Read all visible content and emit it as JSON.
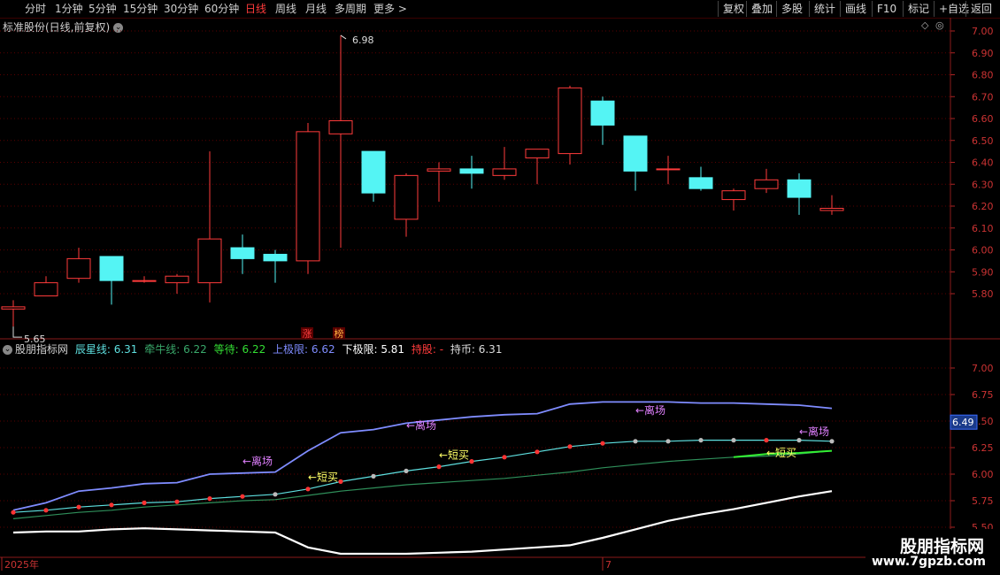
{
  "toolbar": {
    "periods": [
      "分时",
      "1分钟",
      "5分钟",
      "15分钟",
      "30分钟",
      "60分钟",
      "日线",
      "周线",
      "月线",
      "多周期",
      "更多 >"
    ],
    "active_period": "日线",
    "right_buttons": [
      "复权",
      "叠加",
      "多股",
      "统计",
      "画线",
      "F10",
      "标记",
      "+自选",
      "返回"
    ]
  },
  "main_title": "标准股份(日线,前复权)",
  "main_chart": {
    "high_label": "6.98",
    "low_label": "5.65",
    "badges": [
      "涨",
      "榜"
    ]
  },
  "indicator": {
    "name": "股朋指标网",
    "items": [
      {
        "label": "辰星线:",
        "value": "6.31",
        "color": "#5ee0e0"
      },
      {
        "label": "牵牛线:",
        "value": "6.22",
        "color": "#39a86a"
      },
      {
        "label": "等待:",
        "value": "6.22",
        "color": "#33dd33"
      },
      {
        "label": "上极限:",
        "value": "6.62",
        "color": "#7f8cff"
      },
      {
        "label": "下极限:",
        "value": "5.81",
        "color": "#ffffff"
      },
      {
        "label": "持股:",
        "value": "-",
        "color": "#ff3b3b"
      },
      {
        "label": "持币:",
        "value": "6.31",
        "color": "#dddddd"
      }
    ],
    "current_value_tag": "6.49",
    "annotations": [
      {
        "text": "←离场",
        "color": "#e080ff",
        "x": 12,
        "y": 6.46
      },
      {
        "text": "←离场",
        "color": "#e080ff",
        "x": 7,
        "y": 6.12
      },
      {
        "text": "←离场",
        "color": "#e080ff",
        "x": 19,
        "y": 6.6
      },
      {
        "text": "←离场",
        "color": "#e080ff",
        "x": 24,
        "y": 6.4
      },
      {
        "text": "←短买",
        "color": "#ffff66",
        "x": 13,
        "y": 6.18
      },
      {
        "text": "←短买",
        "color": "#ffff66",
        "x": 9,
        "y": 5.97
      },
      {
        "text": "←短买",
        "color": "#ffff66",
        "x": 23,
        "y": 6.2
      }
    ]
  },
  "time_axis": {
    "labels": [
      "2025年",
      "7"
    ]
  },
  "watermark": {
    "title": "股朋指标网",
    "url": "www.7gpzb.com"
  },
  "colors": {
    "up": "#ff3b3b",
    "down": "#54f4f4",
    "grid": "#5a0000",
    "axis_text": "#cc3333",
    "upper": "#7f8cff",
    "star": "#5ee0e0",
    "ox": "#2f8f5a",
    "wait": "#33ee33",
    "lower": "#ffffff"
  },
  "chart_data": [
    {
      "type": "candlestick",
      "title": "标准股份(日线,前复权)",
      "ylim": [
        5.72,
        7.04
      ],
      "yticks": [
        5.8,
        5.9,
        6.0,
        6.1,
        6.2,
        6.3,
        6.4,
        6.5,
        6.6,
        6.7,
        6.8,
        6.9,
        7.0
      ],
      "ohlc": [
        [
          5.73,
          5.77,
          5.65,
          5.74
        ],
        [
          5.79,
          5.88,
          5.79,
          5.85
        ],
        [
          5.87,
          6.01,
          5.85,
          5.96
        ],
        [
          5.97,
          5.97,
          5.75,
          5.86
        ],
        [
          5.86,
          5.88,
          5.85,
          5.86
        ],
        [
          5.85,
          5.89,
          5.8,
          5.88
        ],
        [
          5.85,
          6.45,
          5.76,
          6.05
        ],
        [
          6.01,
          6.07,
          5.89,
          5.96
        ],
        [
          5.98,
          6.0,
          5.85,
          5.95
        ],
        [
          5.95,
          6.58,
          5.89,
          6.54
        ],
        [
          6.53,
          6.98,
          6.01,
          6.59
        ],
        [
          6.45,
          6.45,
          6.22,
          6.26
        ],
        [
          6.14,
          6.35,
          6.06,
          6.34
        ],
        [
          6.36,
          6.4,
          6.22,
          6.37
        ],
        [
          6.37,
          6.43,
          6.28,
          6.35
        ],
        [
          6.34,
          6.47,
          6.32,
          6.37
        ],
        [
          6.42,
          6.46,
          6.3,
          6.46
        ],
        [
          6.44,
          6.75,
          6.39,
          6.74
        ],
        [
          6.68,
          6.7,
          6.48,
          6.57
        ],
        [
          6.52,
          6.52,
          6.27,
          6.36
        ],
        [
          6.37,
          6.43,
          6.3,
          6.37
        ],
        [
          6.33,
          6.38,
          6.27,
          6.28
        ],
        [
          6.23,
          6.28,
          6.18,
          6.27
        ],
        [
          6.28,
          6.37,
          6.26,
          6.32
        ],
        [
          6.32,
          6.35,
          6.16,
          6.24
        ],
        [
          6.18,
          6.25,
          6.16,
          6.19
        ]
      ]
    },
    {
      "type": "line",
      "title": "股朋指标网",
      "ylim": [
        5.5,
        7.0
      ],
      "yticks": [
        5.5,
        5.75,
        6.0,
        6.25,
        6.5,
        6.75,
        7.0
      ],
      "x_count": 26,
      "series": [
        {
          "name": "上极限",
          "color": "#7f8cff",
          "values": [
            5.66,
            5.73,
            5.84,
            5.87,
            5.91,
            5.92,
            6.0,
            6.01,
            6.02,
            6.22,
            6.39,
            6.42,
            6.48,
            6.51,
            6.54,
            6.56,
            6.57,
            6.66,
            6.68,
            6.68,
            6.68,
            6.67,
            6.67,
            6.66,
            6.65,
            6.62
          ]
        },
        {
          "name": "辰星线",
          "color": "#5ee0e0",
          "values": [
            5.64,
            5.66,
            5.69,
            5.71,
            5.73,
            5.74,
            5.77,
            5.79,
            5.81,
            5.86,
            5.93,
            5.98,
            6.03,
            6.07,
            6.12,
            6.16,
            6.21,
            6.26,
            6.29,
            6.31,
            6.31,
            6.32,
            6.32,
            6.32,
            6.32,
            6.31
          ]
        },
        {
          "name": "牵牛线",
          "color": "#2f8f5a",
          "values": [
            5.58,
            5.61,
            5.64,
            5.66,
            5.69,
            5.71,
            5.73,
            5.75,
            5.76,
            5.8,
            5.84,
            5.87,
            5.9,
            5.92,
            5.94,
            5.96,
            5.99,
            6.02,
            6.06,
            6.09,
            6.12,
            6.14,
            6.16,
            6.17,
            6.19,
            6.22
          ]
        },
        {
          "name": "等待",
          "color": "#33ee33",
          "values": [
            null,
            null,
            null,
            null,
            null,
            null,
            null,
            null,
            null,
            null,
            null,
            null,
            null,
            null,
            null,
            null,
            null,
            null,
            null,
            null,
            null,
            null,
            6.16,
            6.19,
            6.2,
            6.22
          ]
        },
        {
          "name": "下极限",
          "color": "#ffffff",
          "values": [
            5.45,
            5.46,
            5.46,
            5.48,
            5.49,
            5.48,
            5.47,
            5.46,
            5.45,
            5.31,
            5.25,
            5.25,
            5.25,
            5.26,
            5.27,
            5.29,
            5.31,
            5.33,
            5.4,
            5.48,
            5.56,
            5.62,
            5.67,
            5.73,
            5.79,
            5.84
          ]
        }
      ],
      "dot_colors": [
        "#ff3333",
        "#ff3333",
        "#ff3333",
        "#ff3333",
        "#ff3333",
        "#ff3333",
        "#ff3333",
        "#ff3333",
        "#bbbbbb",
        "#ff3333",
        "#ff3333",
        "#bbbbbb",
        "#bbbbbb",
        "#ff3333",
        "#ff3333",
        "#ff3333",
        "#ff3333",
        "#ff3333",
        "#ff3333",
        "#bbbbbb",
        "#bbbbbb",
        "#bbbbbb",
        "#bbbbbb",
        "#ff3333",
        "#bbbbbb",
        "#bbbbbb"
      ]
    }
  ]
}
